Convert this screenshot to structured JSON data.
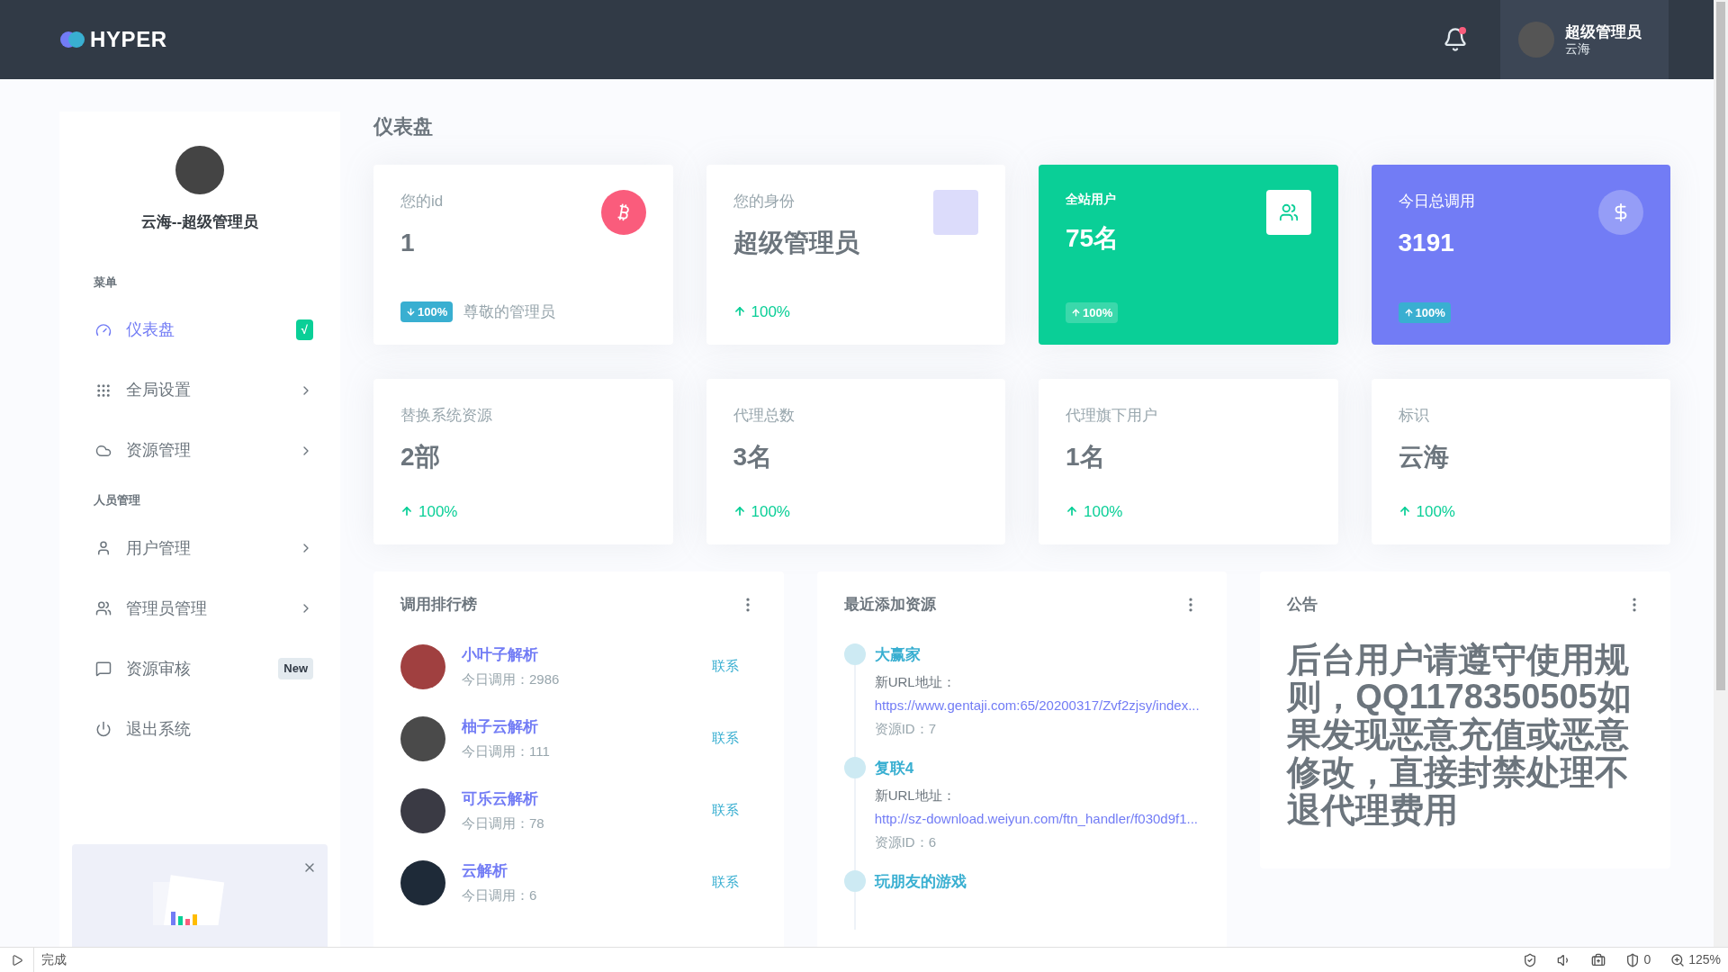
{
  "header": {
    "logo": "HYPER",
    "notification_unread": true,
    "user": {
      "name": "超级管理员",
      "subtitle": "云海"
    }
  },
  "sidebar": {
    "profile_name": "云海--超级管理员",
    "sections": [
      {
        "title": "菜单",
        "items": [
          {
            "label": "仪表盘",
            "selected": true,
            "has_submenu": false,
            "badge": {
              "text": "√",
              "kind": "success"
            }
          },
          {
            "label": "全局设置",
            "selected": false,
            "has_submenu": true
          },
          {
            "label": "资源管理",
            "selected": false,
            "has_submenu": true
          }
        ]
      },
      {
        "title": "人员管理",
        "items": [
          {
            "label": "用户管理",
            "selected": false,
            "has_submenu": true
          },
          {
            "label": "管理员管理",
            "selected": false,
            "has_submenu": true
          },
          {
            "label": "资源审核",
            "selected": false,
            "has_submenu": false,
            "badge": {
              "text": "New",
              "kind": "light"
            }
          },
          {
            "label": "退出系统",
            "selected": false,
            "has_submenu": false
          }
        ]
      }
    ]
  },
  "page_title": "仪表盘",
  "stat_cards": [
    {
      "kind": "light",
      "label": "您的id",
      "value": "1",
      "trend": {
        "kind": "badge",
        "down": true,
        "text": "100%"
      },
      "note": "尊敬的管理员"
    },
    {
      "kind": "light",
      "label": "您的身份",
      "value": "超级管理员",
      "trend": {
        "kind": "text",
        "down": false,
        "text": "100%"
      }
    },
    {
      "kind": "success",
      "label": "全站用户",
      "value": "75名",
      "trend": {
        "kind": "badge",
        "down": false,
        "text": "100%"
      }
    },
    {
      "kind": "primary",
      "label": "今日总调用",
      "value": "3191",
      "trend": {
        "kind": "badge",
        "down": false,
        "text": "100%"
      }
    },
    {
      "kind": "light",
      "label": "替换系统资源",
      "value": "2部",
      "trend": {
        "kind": "text",
        "down": false,
        "text": "100%"
      }
    },
    {
      "kind": "light",
      "label": "代理总数",
      "value": "3名",
      "trend": {
        "kind": "text",
        "down": false,
        "text": "100%"
      }
    },
    {
      "kind": "light",
      "label": "代理旗下用户",
      "value": "1名",
      "trend": {
        "kind": "text",
        "down": false,
        "text": "100%"
      }
    },
    {
      "kind": "light",
      "label": "标识",
      "value": "云海",
      "trend": {
        "kind": "text",
        "down": false,
        "text": "100%"
      }
    }
  ],
  "ranking": {
    "title": "调用排行榜",
    "rows": [
      {
        "name": "小叶子解析",
        "calls": "今日调用：2986",
        "action": "联系"
      },
      {
        "name": "柚子云解析",
        "calls": "今日调用：111",
        "action": "联系"
      },
      {
        "name": "可乐云解析",
        "calls": "今日调用：78",
        "action": "联系"
      },
      {
        "name": "云解析",
        "calls": "今日调用：6",
        "action": "联系"
      }
    ]
  },
  "recent_resources": {
    "title": "最近添加资源",
    "items": [
      {
        "title": "大赢家",
        "url_label": "新URL地址：",
        "url": "https://www.gentaji.com:65/20200317/Zvf2zjsy/index...",
        "resource_id": "资源ID：7"
      },
      {
        "title": "复联4",
        "url_label": "新URL地址：",
        "url": "http://sz-download.weiyun.com/ftn_handler/f030d9f1...",
        "resource_id": "资源ID：6"
      },
      {
        "title": "玩朋友的游戏"
      }
    ]
  },
  "notice": {
    "title": "公告",
    "text": "后台用户请遵守使用规则，QQ1178350505如果发现恶意充值或恶意修改，直接封禁处理不退代理费用"
  },
  "status_bar": {
    "status": "完成",
    "ad_count": "0",
    "zoom": "125%"
  }
}
